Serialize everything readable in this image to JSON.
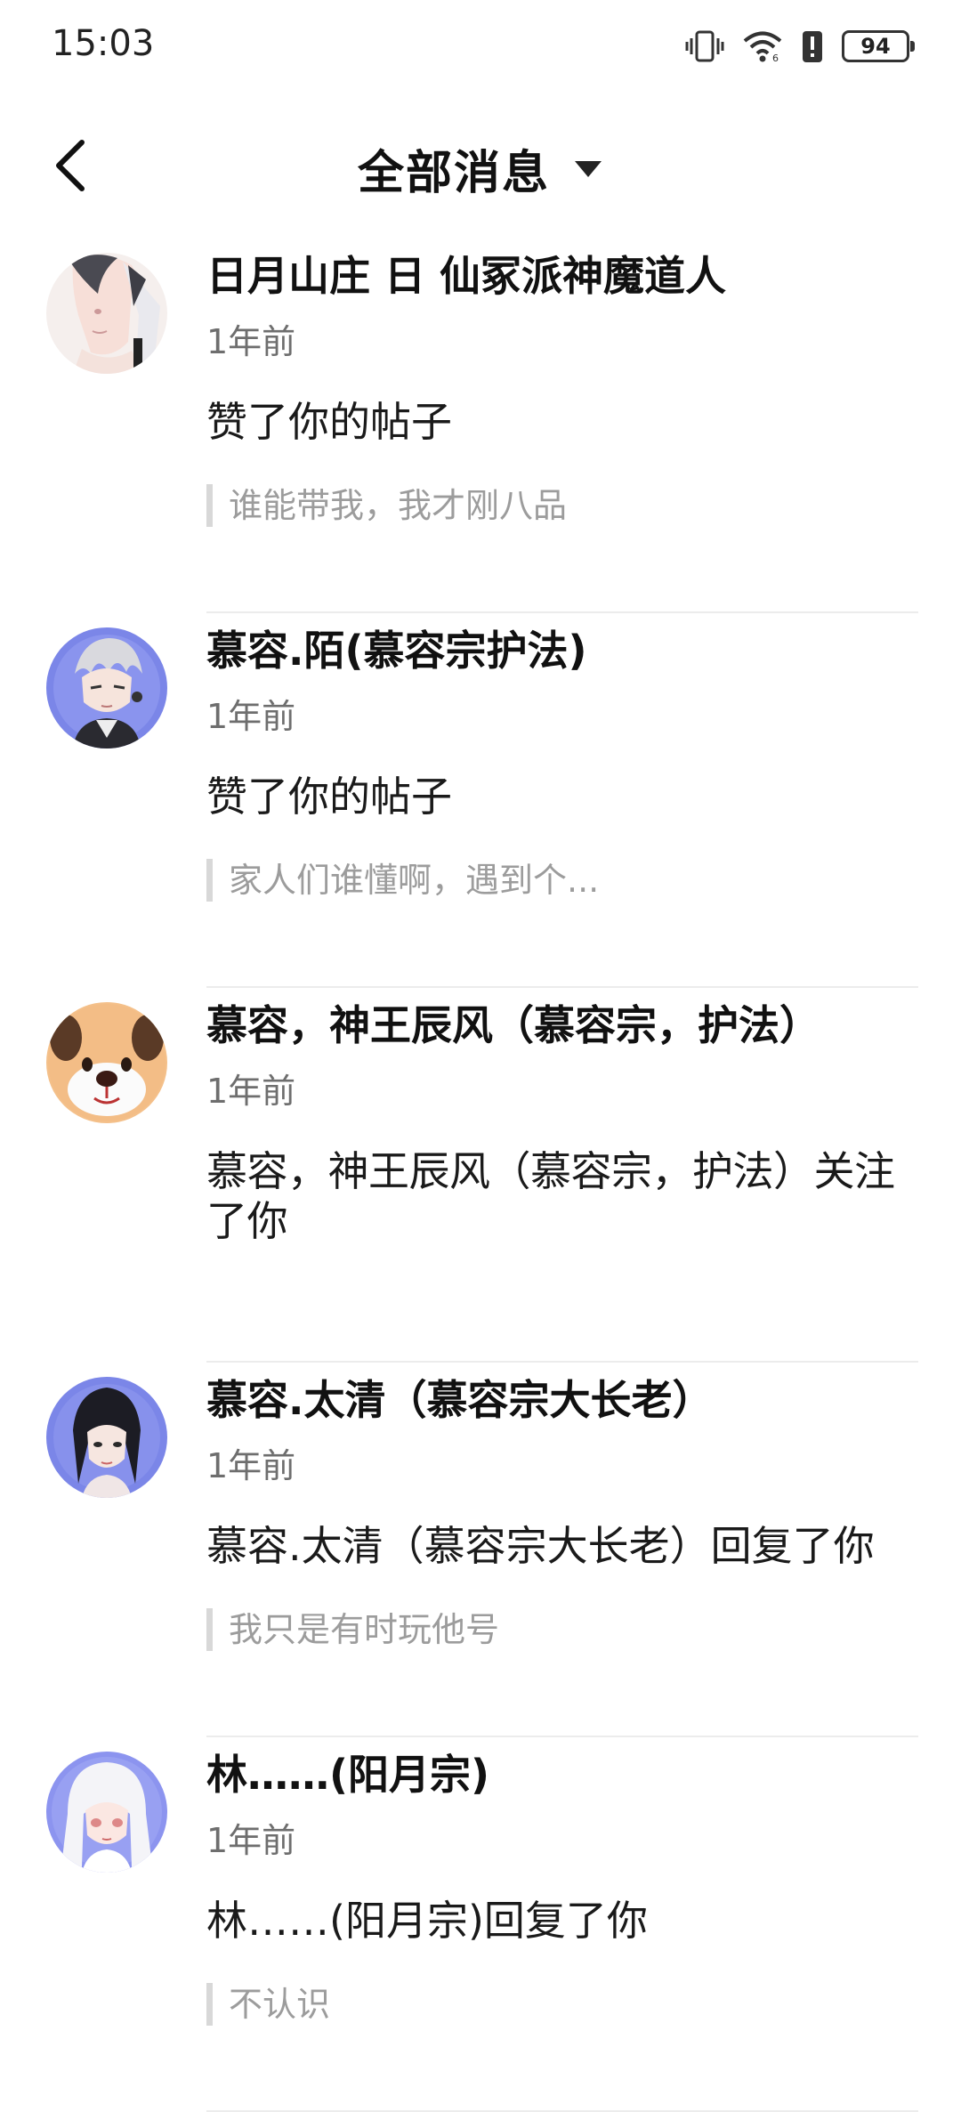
{
  "status_bar": {
    "time": "15:03",
    "battery": "94",
    "icons": [
      "vibrate-icon",
      "wifi-icon",
      "battery-alert-icon",
      "battery-icon"
    ]
  },
  "header": {
    "back_icon": "back-arrow-icon",
    "title": "全部消息",
    "dropdown_icon": "caret-down-icon"
  },
  "messages": [
    {
      "name": "日月山庄 日  仙冢派神魔道人",
      "time": "1年前",
      "action": "赞了你的帖子",
      "quote": "谁能带我，我才刚八品",
      "avatar_color": "#f3e9e6"
    },
    {
      "name": "慕容.陌(慕容宗护法)",
      "time": "1年前",
      "action": "赞了你的帖子",
      "quote": "家人们谁懂啊，遇到个...",
      "avatar_color": "#7b86e8"
    },
    {
      "name": "慕容，神王辰风（慕容宗，护法）",
      "time": "1年前",
      "action": "慕容，神王辰风（慕容宗，护法）关注了你",
      "quote": "",
      "avatar_color": "#f4c08a"
    },
    {
      "name": "慕容.太清（慕容宗大长老）",
      "time": "1年前",
      "action": "慕容.太清（慕容宗大长老）回复了你",
      "quote": "我只是有时玩他号",
      "avatar_color": "#7b86e8"
    },
    {
      "name": "林……(阳月宗)",
      "time": "1年前",
      "action": "林……(阳月宗)回复了你",
      "quote": "不认识",
      "avatar_color": "#8c94ef"
    }
  ]
}
